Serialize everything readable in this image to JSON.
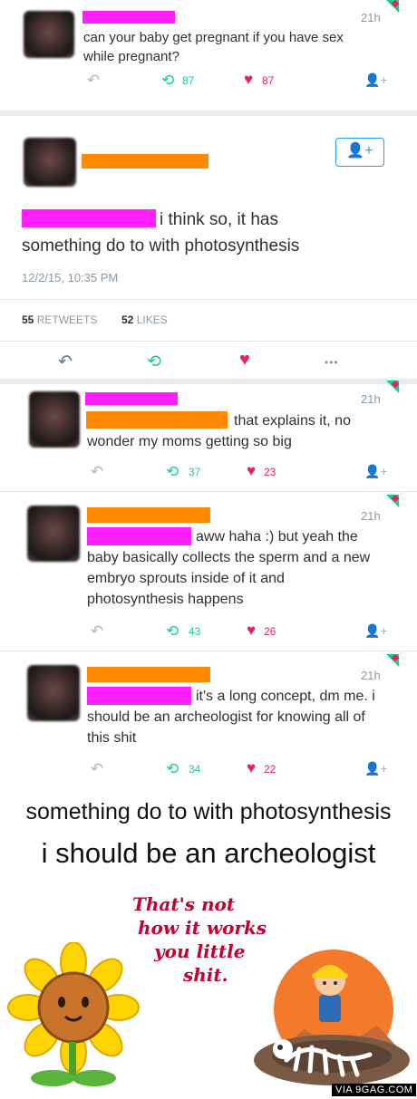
{
  "tweets": [
    {
      "time": "21h",
      "text": "can your baby get pregnant if you have sex while pregnant?",
      "retweets": "87",
      "likes": "87"
    },
    {
      "time": "21h",
      "text": "that explains it, no wonder my moms getting so big",
      "retweets": "37",
      "likes": "23"
    },
    {
      "time": "21h",
      "text": "aww haha :) but yeah the baby basically collects the sperm and a new embryo sprouts inside of it and photosynthesis happens",
      "retweets": "43",
      "likes": "26"
    },
    {
      "time": "21h",
      "text": "it's a long concept, dm me. i should be an archeologist for knowing all of this shit",
      "retweets": "34",
      "likes": "22"
    }
  ],
  "main_tweet": {
    "text_line1": "i think so, it has",
    "text_line2": "something do to with photosynthesis",
    "timestamp": "12/2/15, 10:35 PM",
    "retweets_count": "55",
    "retweets_label": "RETWEETS",
    "likes_count": "52",
    "likes_label": "LIKES"
  },
  "captions": {
    "line1": "something do to with photosynthesis",
    "line2": "i should be an archeologist"
  },
  "comic": {
    "note_line1": "That's not",
    "note_line2": "how it works",
    "note_line3": "you little",
    "note_line4": "shit.",
    "watermark": "VIA 9GAG.COM"
  },
  "icons": {
    "reply": "↶",
    "retweet": "⟲",
    "like": "♥",
    "follow": "👤+",
    "more": "•••"
  },
  "colors": {
    "pink_redaction": "#ff1eff",
    "orange_redaction": "#ff8a00",
    "retweet_green": "#19cf86",
    "like_red": "#e0245e",
    "link_blue": "#1da1f2"
  }
}
